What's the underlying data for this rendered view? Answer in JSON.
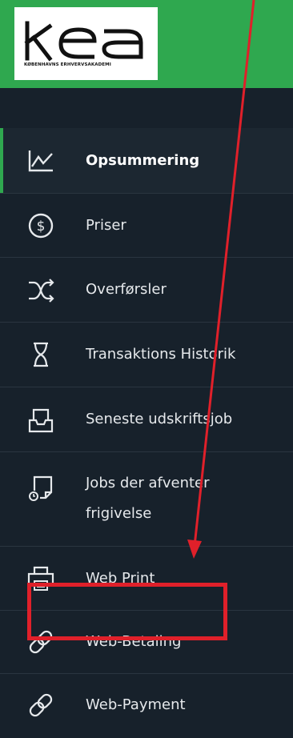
{
  "logo": {
    "wordmark": "kea",
    "subtitle": "KØBENHAVNS ERHVERVSAKADEMI"
  },
  "colors": {
    "header_green": "#2fa84f",
    "sidebar_bg": "#17212b",
    "annotation_red": "#e0202a",
    "active_accent": "#2fa84f"
  },
  "nav": {
    "items": [
      {
        "label": "Opsummering",
        "icon": "chart-line-icon",
        "active": true
      },
      {
        "label": "Priser",
        "icon": "dollar-circle-icon",
        "active": false
      },
      {
        "label": "Overførsler",
        "icon": "shuffle-arrows-icon",
        "active": false
      },
      {
        "label": "Transaktions Historik",
        "icon": "hourglass-icon",
        "active": false
      },
      {
        "label": "Seneste udskriftsjob",
        "icon": "inbox-tray-icon",
        "active": false
      },
      {
        "label": "Jobs der afventer",
        "label_line2": "frigivelse",
        "icon": "document-clock-icon",
        "active": false
      },
      {
        "label": "Web Print",
        "icon": "printer-icon",
        "active": false
      },
      {
        "label": "Web-Betaling",
        "icon": "link-chain-icon",
        "active": false,
        "highlighted": true
      },
      {
        "label": "Web-Payment",
        "icon": "link-chain-icon",
        "active": false
      }
    ]
  },
  "annotation": {
    "type": "arrow-and-box",
    "target": "Web-Betaling"
  }
}
